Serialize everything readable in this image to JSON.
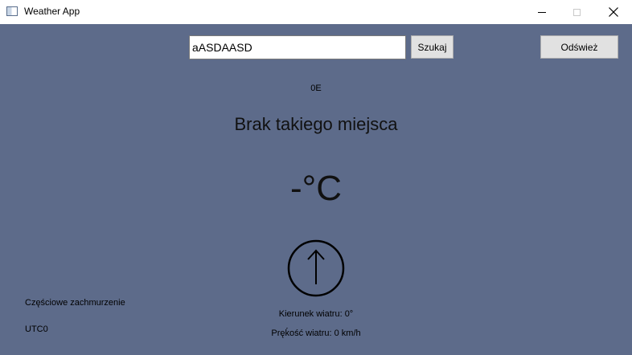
{
  "window": {
    "title": "Weather App",
    "minimize_icon": "minimize-icon",
    "maximize_icon": "maximize-icon",
    "close_icon": "close-icon"
  },
  "search": {
    "value": "aASDAASD",
    "button_label": "Szukaj"
  },
  "refresh": {
    "button_label": "Odśwież"
  },
  "location": {
    "coords": "0E",
    "place": "Brak takiego miejsca"
  },
  "weather": {
    "temperature": "-°C",
    "condition": "Częściowe zachmurzenie",
    "timezone": "UTC0",
    "wind_direction_label": "Kierunek wiatru: 0°",
    "wind_speed_label": "Pręḱość wiatru: 0 km/h",
    "wind_direction_degrees": 0,
    "compass_icon": "wind-direction-arrow-icon"
  },
  "colors": {
    "background": "#5d6b8a",
    "titlebar": "#ffffff",
    "button": "#e1e1e1"
  }
}
